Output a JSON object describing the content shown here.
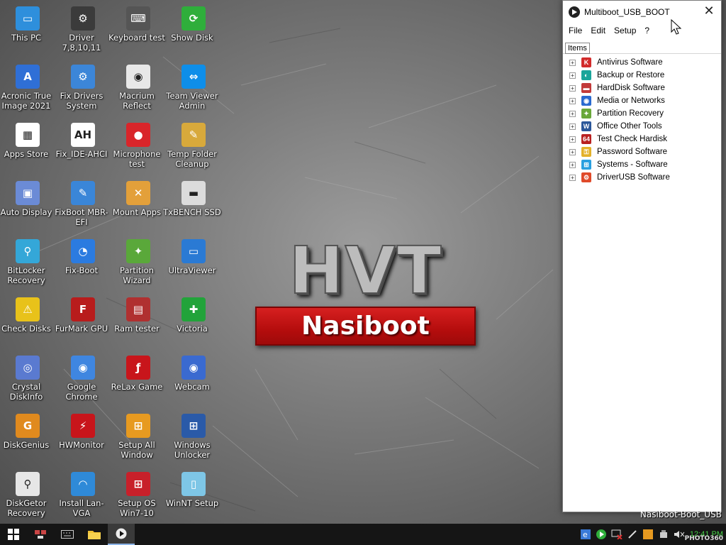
{
  "desktop": {
    "icons": [
      {
        "label": "This PC",
        "icon": "computer-icon",
        "color": "#2e8fdc"
      },
      {
        "label": "Driver 7,8,10,11",
        "icon": "driver-icon",
        "color": "#3b3b3b"
      },
      {
        "label": "Keyboard test",
        "icon": "keyboard-icon",
        "color": "#555555"
      },
      {
        "label": "Show Disk",
        "icon": "refresh-icon",
        "color": "#2fae3b"
      },
      {
        "label": "Acronic True Image 2021",
        "icon": "acronis-icon",
        "color": "#2f6fd6"
      },
      {
        "label": "Fix Drivers System",
        "icon": "fix-drivers-icon",
        "color": "#3c86d8"
      },
      {
        "label": "Macrium Reflect",
        "icon": "macrium-icon",
        "color": "#e8e8e8"
      },
      {
        "label": "Team Viewer Admin",
        "icon": "teamviewer-icon",
        "color": "#0e8ee9"
      },
      {
        "label": "Apps Store",
        "icon": "store-icon",
        "color": "#ffffff"
      },
      {
        "label": "Fix_IDE-AHCI",
        "icon": "ahci-icon",
        "color": "#ffffff"
      },
      {
        "label": "Microphone test",
        "icon": "microphone-icon",
        "color": "#d9252a"
      },
      {
        "label": "Temp Folder Cleanup",
        "icon": "broom-icon",
        "color": "#d8a93b"
      },
      {
        "label": "Auto Display",
        "icon": "display-icon",
        "color": "#6b8bd6"
      },
      {
        "label": "FixBoot MBR-EFI",
        "icon": "wrench-icon",
        "color": "#3a86d8"
      },
      {
        "label": "Mount Apps",
        "icon": "tools-icon",
        "color": "#e3a03a"
      },
      {
        "label": "TxBENCH SSD",
        "icon": "ssd-icon",
        "color": "#dcdcdc"
      },
      {
        "label": "BitLocker Recovery",
        "icon": "bitlocker-icon",
        "color": "#34a7d8"
      },
      {
        "label": "Fix-Boot",
        "icon": "pie-icon",
        "color": "#2b7be0"
      },
      {
        "label": "Partition Wizard",
        "icon": "partition-wizard-icon",
        "color": "#5aa83a"
      },
      {
        "label": "UltraViewer",
        "icon": "ultraviewer-icon",
        "color": "#2a7ad4"
      },
      {
        "label": "Check Disks",
        "icon": "warning-icon",
        "color": "#e8c21a"
      },
      {
        "label": "FurMark GPU",
        "icon": "furmark-icon",
        "color": "#b81c1c"
      },
      {
        "label": "Ram tester",
        "icon": "ram-icon",
        "color": "#b03030"
      },
      {
        "label": "Victoria",
        "icon": "plus-icon",
        "color": "#22a33a"
      },
      {
        "label": "Crystal DiskInfo",
        "icon": "crystaldiskinfo-icon",
        "color": "#5a7ad0"
      },
      {
        "label": "Google Chrome",
        "icon": "chrome-icon",
        "color": "#3f86e0"
      },
      {
        "label": "ReLax Game",
        "icon": "flash-icon",
        "color": "#c8151b"
      },
      {
        "label": "Webcam",
        "icon": "webcam-icon",
        "color": "#3a6ad0"
      },
      {
        "label": "DiskGenius",
        "icon": "diskgenius-icon",
        "color": "#e08a1e"
      },
      {
        "label": "HWMonitor",
        "icon": "hwmonitor-icon",
        "color": "#c8151b"
      },
      {
        "label": "Setup All Window",
        "icon": "windows-setup-icon",
        "color": "#e79a20"
      },
      {
        "label": "Windows Unlocker",
        "icon": "windows-unlocker-icon",
        "color": "#2a5aa8"
      },
      {
        "label": "DiskGetor Recovery",
        "icon": "magnifier-icon",
        "color": "#e6e6e6"
      },
      {
        "label": "Install Lan-VGA",
        "icon": "wifi-icon",
        "color": "#2f8ad8"
      },
      {
        "label": "Setup OS Win7-10",
        "icon": "windows-setup-icon",
        "color": "#c8202a"
      },
      {
        "label": "WinNT Setup",
        "icon": "winntsetup-icon",
        "color": "#7ec6e6"
      }
    ]
  },
  "logo": {
    "title": "HVT",
    "subtitle": "Nasiboot"
  },
  "window": {
    "title": "Multiboot_USB_BOOT",
    "close_label": "✕",
    "menu": [
      "File",
      "Edit",
      "Setup",
      "?"
    ],
    "tab_label": "Items",
    "tree": [
      {
        "label": "Antivirus Software",
        "icon": "antivirus-icon",
        "color": "#d22b2b"
      },
      {
        "label": "Backup or Restore",
        "icon": "backup-icon",
        "color": "#1aa59a"
      },
      {
        "label": "HardDisk Software",
        "icon": "harddisk-icon",
        "color": "#c23a3a"
      },
      {
        "label": "Media or Networks",
        "icon": "network-icon",
        "color": "#2a6ad0"
      },
      {
        "label": "Partition Recovery",
        "icon": "partition-icon",
        "color": "#6aa83a"
      },
      {
        "label": "Office Other Tools",
        "icon": "word-icon",
        "color": "#2b579a"
      },
      {
        "label": "Test Check Hardisk",
        "icon": "test-64-icon",
        "color": "#b82020"
      },
      {
        "label": "Password Software",
        "icon": "key-icon",
        "color": "#e3b12a"
      },
      {
        "label": "Systems - Software",
        "icon": "windows-icon",
        "color": "#2aa0e0"
      },
      {
        "label": "DriverUSB Software",
        "icon": "driver-usb-icon",
        "color": "#e04a2a"
      }
    ]
  },
  "overlay": {
    "text": "Nasiboot-Boot_USB"
  },
  "taskbar": {
    "clock": "12:41 PM",
    "watermark": "PHOTO360"
  }
}
